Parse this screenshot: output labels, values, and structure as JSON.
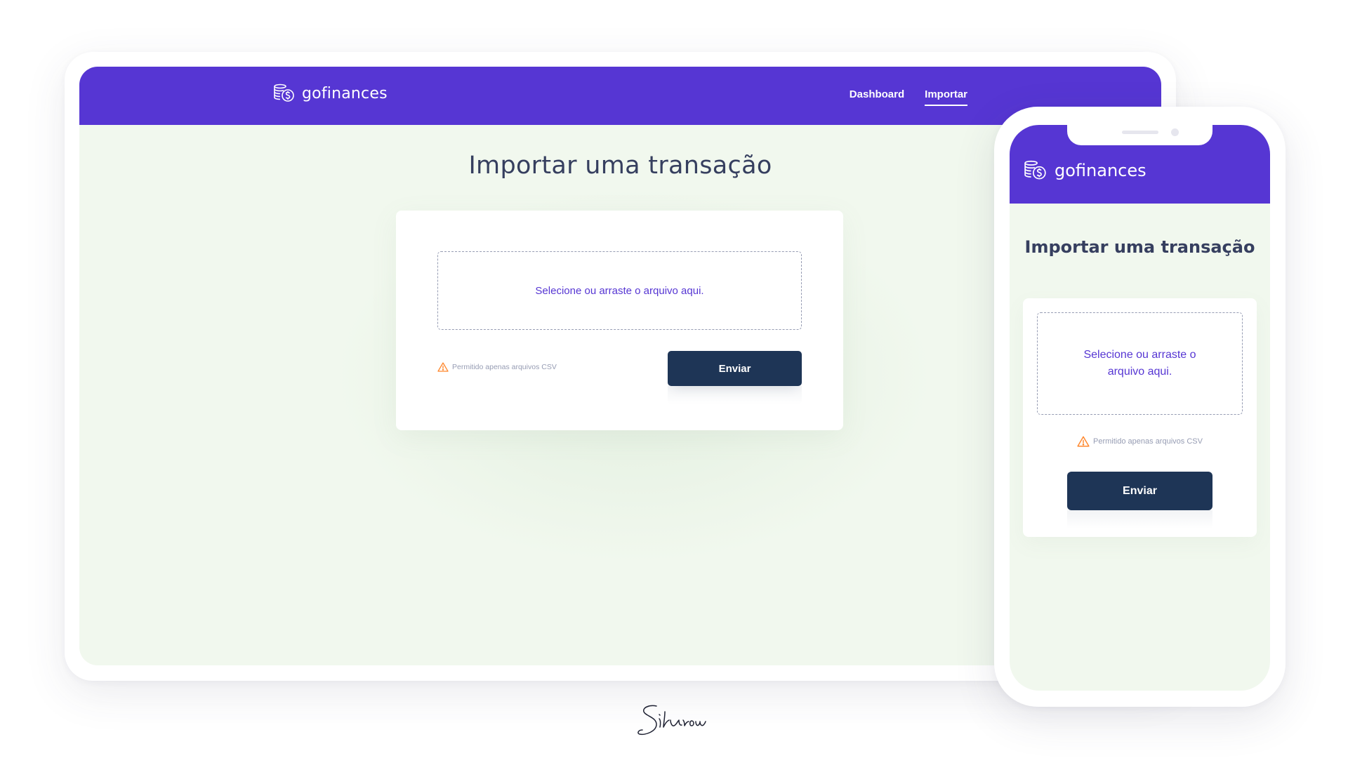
{
  "brand": {
    "name": "gofinances",
    "primary_color": "#5636d3",
    "background_color": "#f1f8ee",
    "button_color": "#1e3556",
    "title_color": "#363f5f",
    "muted_color": "#969cb3",
    "warning_color": "#ff872c"
  },
  "desktop": {
    "nav": {
      "dashboard_label": "Dashboard",
      "import_label": "Importar",
      "active": "Importar"
    },
    "title": "Importar uma transação",
    "dropzone_text": "Selecione ou arraste o arquivo aqui.",
    "hint_text": "Permitido apenas arquivos CSV",
    "submit_label": "Enviar"
  },
  "mobile": {
    "title": "Importar uma transação",
    "dropzone_text": "Selecione ou arraste o arquivo aqui.",
    "hint_text": "Permitido apenas arquivos CSV",
    "submit_label": "Enviar"
  },
  "icons": {
    "logo": "coins-dollar-icon",
    "warning": "warning-triangle-icon"
  }
}
